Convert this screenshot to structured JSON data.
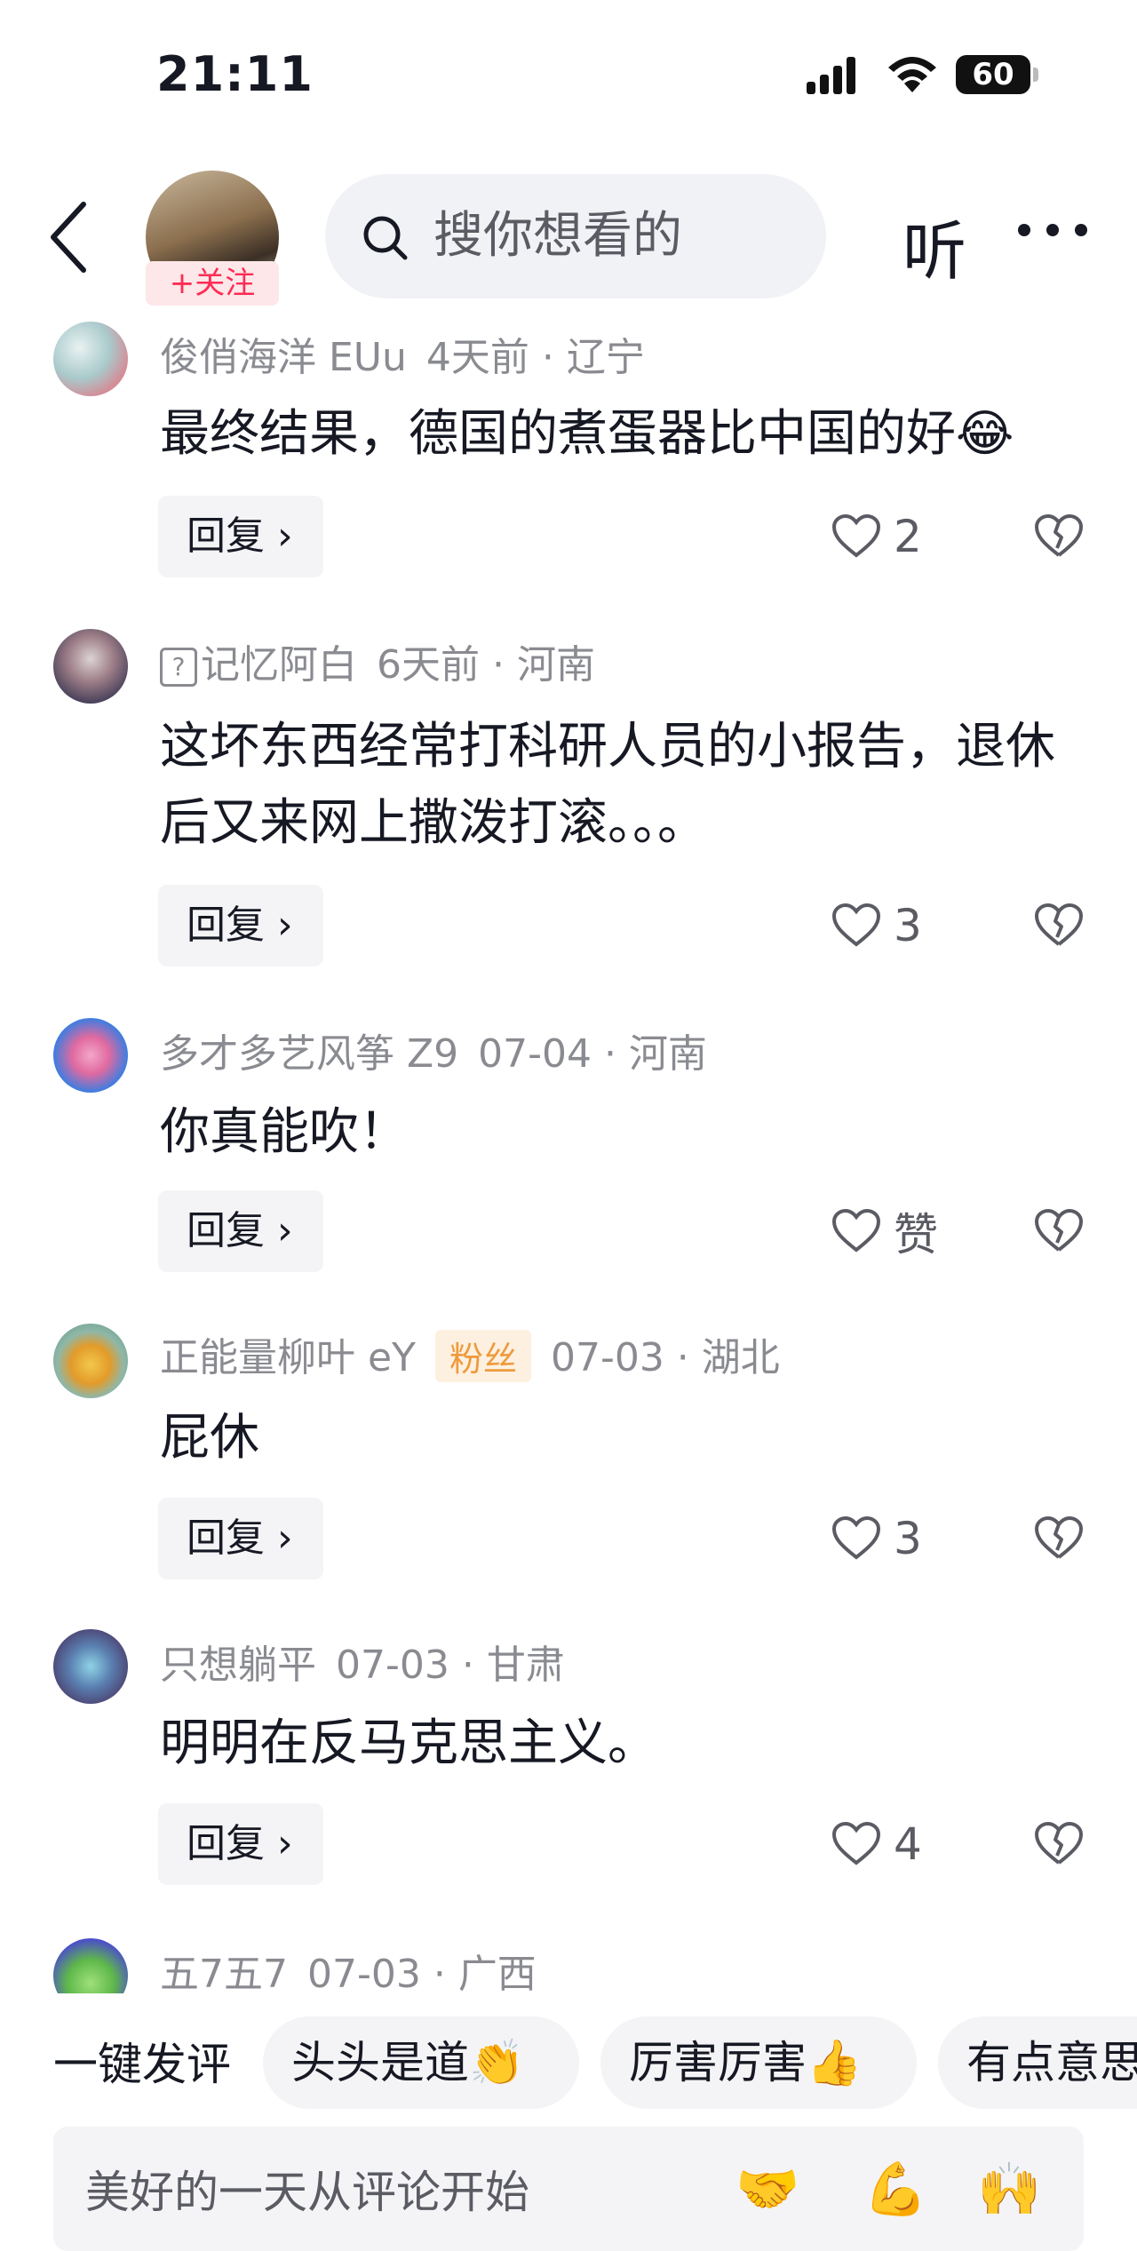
{
  "status_bar": {
    "time": "21:11",
    "battery": "60"
  },
  "header": {
    "follow_label": "+关注",
    "search_placeholder": "搜你想看的",
    "listen_label": "听"
  },
  "comments": [
    {
      "name": "俊俏海洋 EUu",
      "time_location": "4天前 · 辽宁",
      "badge": "",
      "text": "最终结果，德国的煮蛋器比中国的好😂",
      "likes": "2"
    },
    {
      "name": "记忆阿白",
      "time_location": "6天前 · 河南",
      "badge": "",
      "text": "这坏东西经常打科研人员的小报告，退休后又来网上撒泼打滚。。。",
      "likes": "3"
    },
    {
      "name": "多才多艺风筝 Z9",
      "time_location": "07-04 · 河南",
      "badge": "",
      "text": "你真能吹！",
      "likes": "赞"
    },
    {
      "name": "正能量柳叶 eY",
      "time_location": "07-03 · 湖北",
      "badge": "粉丝",
      "text": "屁休",
      "likes": "3"
    },
    {
      "name": "只想躺平",
      "time_location": "07-03 · 甘肃",
      "badge": "",
      "text": "明明在反马克思主义。",
      "likes": "4"
    },
    {
      "name": "五7五7",
      "time_location": "07-03 · 广西",
      "badge": "",
      "text": "",
      "likes": ""
    }
  ],
  "reply_label": "回复 ›",
  "quick_comment": {
    "label": "一键发评",
    "chips": [
      "头头是道👏",
      "厉害厉害👍",
      "有点意思"
    ]
  },
  "input": {
    "placeholder": "美好的一天从评论开始",
    "emojis": [
      "🤝",
      "💪",
      "🙌"
    ]
  },
  "colors": {
    "accent": "#fe2c55",
    "meta": "#8a8b91",
    "chip_bg": "#f4f4f6",
    "fan_badge": "#ee9b3d"
  }
}
